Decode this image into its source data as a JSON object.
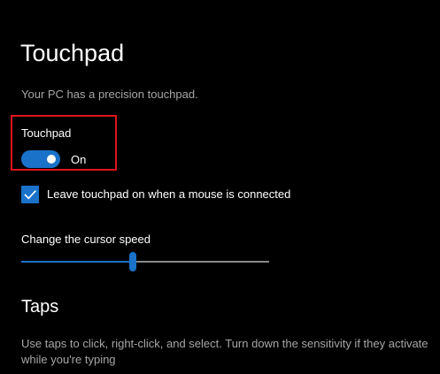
{
  "page": {
    "title": "Touchpad",
    "subtitle": "Your PC has a precision touchpad."
  },
  "touchpad_toggle": {
    "label": "Touchpad",
    "state_text": "On",
    "on": true
  },
  "mouse_connected_checkbox": {
    "label": "Leave touchpad on when a mouse is connected",
    "checked": true
  },
  "cursor_speed": {
    "label": "Change the cursor speed",
    "value_fraction": 0.45
  },
  "taps": {
    "title": "Taps",
    "description": "Use taps to click, right-click, and select. Turn down the sensitivity if they activate while you're typing"
  },
  "colors": {
    "accent": "#1a73c9",
    "highlight": "#e0141e",
    "background": "#000000",
    "secondary_text": "#a6a6a6"
  }
}
